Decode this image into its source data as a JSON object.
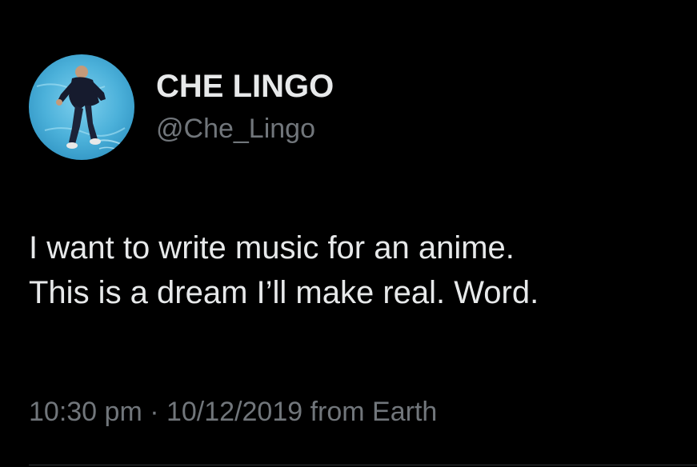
{
  "tweet": {
    "display_name": "CHE LINGO",
    "handle": "@Che_Lingo",
    "text_lines": [
      "I want to write music for an anime.",
      "This is a dream I’ll make real. Word."
    ],
    "time": "10:30 pm",
    "separator": " · ",
    "date": "10/12/2019",
    "source": " from Earth"
  },
  "colors": {
    "background": "#000000",
    "primary_text": "#e7e9ea",
    "secondary_text": "#71767b",
    "avatar_bg": "#4fb0d8"
  },
  "icons": {
    "avatar": "profile-photo"
  }
}
